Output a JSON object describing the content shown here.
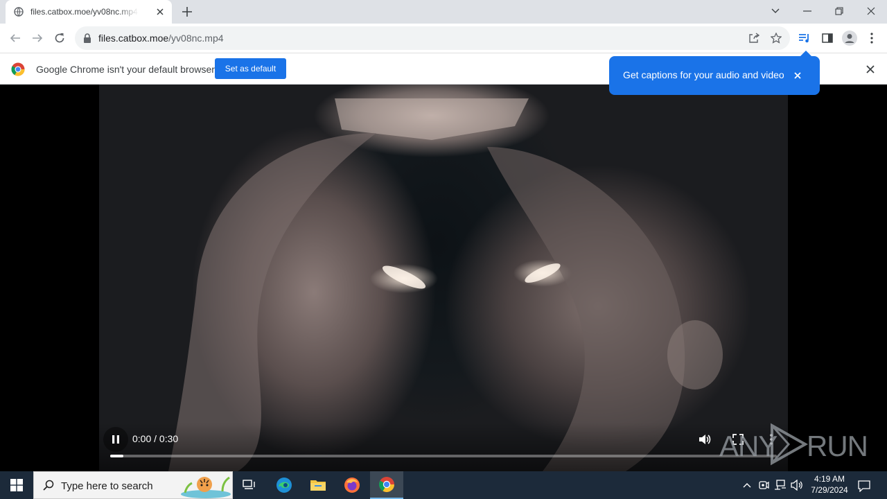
{
  "browser": {
    "tab_title": "files.catbox.moe/yv08nc.mp4",
    "url_domain": "files.catbox.moe",
    "url_path": "/yv08nc.mp4"
  },
  "infobar": {
    "message": "Google Chrome isn't your default browser",
    "button": "Set as default"
  },
  "bubble": {
    "text": "Get captions for your audio and video"
  },
  "video": {
    "time": "0:00 / 0:30",
    "progress": 0.02
  },
  "watermark": {
    "left": "ANY",
    "right": "RUN"
  },
  "taskbar": {
    "search_placeholder": "Type here to search",
    "time": "4:19 AM",
    "date": "7/29/2024"
  },
  "colors": {
    "accent": "#1a73e8",
    "taskbar": "#1c2a3a"
  }
}
